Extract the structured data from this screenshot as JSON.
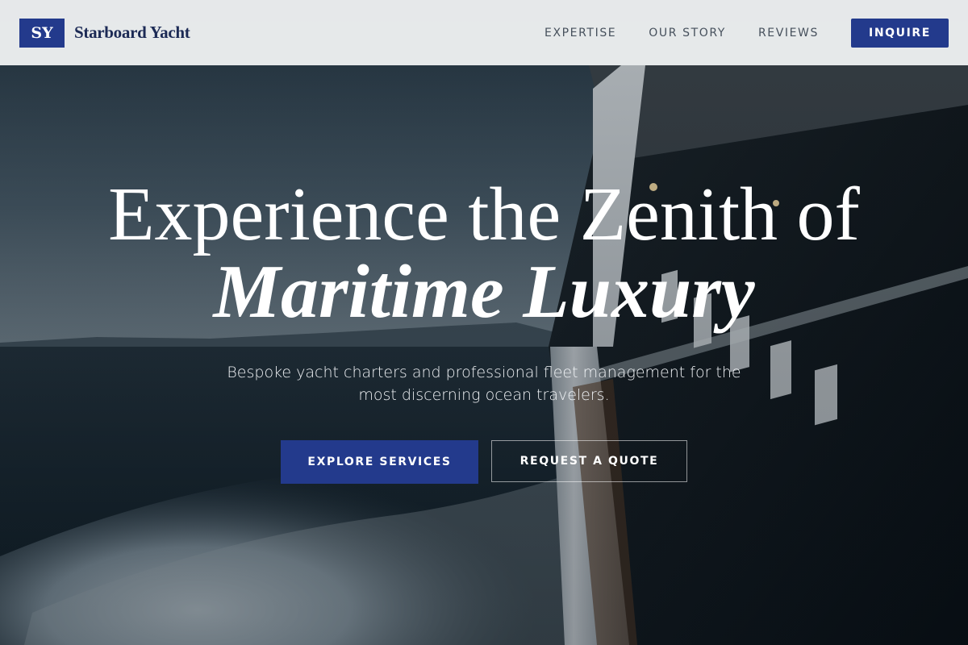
{
  "header": {
    "logo_mark": "SY",
    "brand_name": "Starboard Yacht",
    "nav": [
      "EXPERTISE",
      "OUR STORY",
      "REVIEWS"
    ],
    "cta_label": "INQUIRE"
  },
  "hero": {
    "headline_line1": "Experience the Zenith of",
    "headline_line2": "Maritime Luxury",
    "subtext": "Bespoke yacht charters and professional fleet management for the most discerning ocean travelers.",
    "primary_cta": "EXPLORE SERVICES",
    "secondary_cta": "REQUEST A QUOTE"
  },
  "colors": {
    "brand_navy": "#233a8c",
    "header_bg": "#eef0f1",
    "nav_text": "#46505c",
    "hero_text": "#ffffff"
  }
}
